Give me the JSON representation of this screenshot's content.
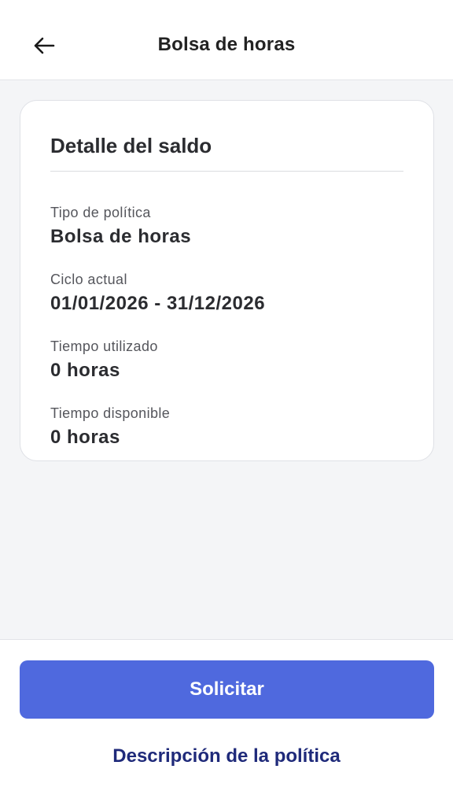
{
  "header": {
    "title": "Bolsa de horas",
    "back_icon": "arrow-left-icon"
  },
  "card": {
    "title": "Detalle del saldo",
    "fields": [
      {
        "label": "Tipo de política",
        "value": "Bolsa de horas"
      },
      {
        "label": "Ciclo actual",
        "value": "01/01/2026 - 31/12/2026"
      },
      {
        "label": "Tiempo utilizado",
        "value": "0 horas"
      },
      {
        "label": "Tiempo disponible",
        "value": "0 horas"
      }
    ]
  },
  "footer": {
    "primary_label": "Solicitar",
    "link_label": "Descripción de la política"
  },
  "colors": {
    "primary": "#4f69de",
    "link": "#1f2a7a",
    "background": "#f4f5f7"
  }
}
